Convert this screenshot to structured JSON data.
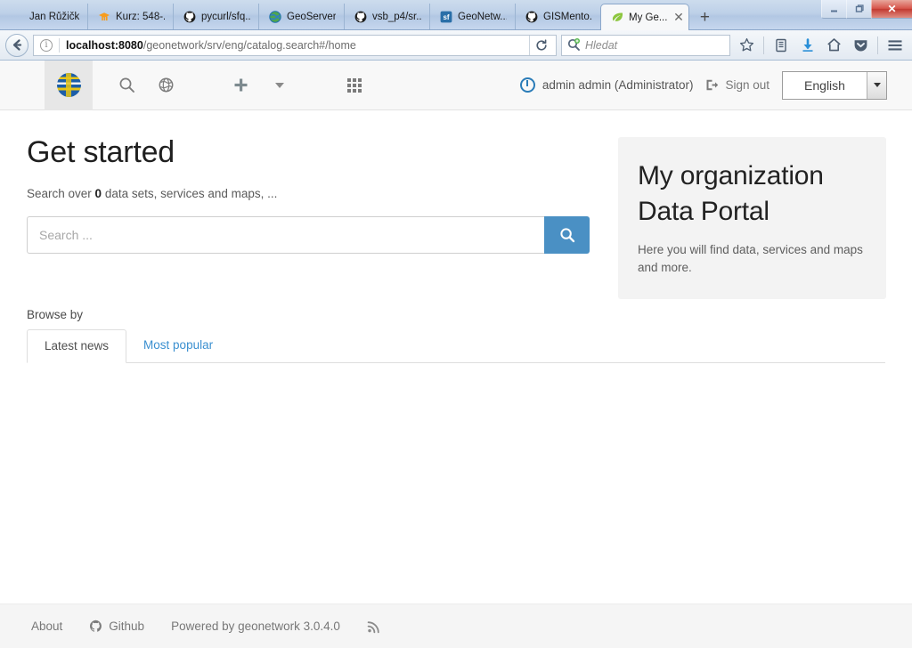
{
  "browser": {
    "tabs": [
      {
        "title": "Jan Růžička - s...",
        "favicon": "none-icon",
        "active": false
      },
      {
        "title": "Kurz: 548-...",
        "favicon": "moodle-icon",
        "active": false
      },
      {
        "title": "pycurl/sfq...",
        "favicon": "github-icon",
        "active": false
      },
      {
        "title": "GeoServer...",
        "favicon": "geoserver-icon",
        "active": false
      },
      {
        "title": "vsb_p4/sr...",
        "favicon": "github-icon",
        "active": false
      },
      {
        "title": "GeoNetw...",
        "favicon": "sourceforge-icon",
        "active": false
      },
      {
        "title": "GISMento...",
        "favicon": "github-icon",
        "active": false
      },
      {
        "title": "My Ge...",
        "favicon": "geonetwork-leaf-icon",
        "active": true
      }
    ],
    "new_tab_label": "+",
    "tab_close_label": "✕",
    "window_controls": {
      "minimize": "—",
      "restore": "❐",
      "close": "✕"
    },
    "back_label": "←",
    "url_host": "localhost:8080",
    "url_path": "/geonetwork/srv/eng/catalog.search#/home",
    "reload_label": "⟳",
    "search_placeholder": "Hledat",
    "nav_icons": [
      "bookmark-star-icon",
      "library-icon",
      "downloads-icon",
      "home-icon",
      "pocket-icon",
      "menu-icon"
    ]
  },
  "app_header": {
    "logo_name": "geonetwork-logo",
    "nav_items": [
      {
        "name": "search-icon",
        "label": ""
      },
      {
        "name": "map-globe-icon",
        "label": ""
      },
      {
        "name": "add-icon",
        "label": ""
      },
      {
        "name": "chevron-down-icon",
        "label": ""
      },
      {
        "name": "apps-grid-icon",
        "label": ""
      }
    ],
    "user_label": "admin admin (Administrator)",
    "signout_label": "Sign out",
    "language": "English",
    "language_options": [
      "English"
    ]
  },
  "main": {
    "heading": "Get started",
    "subtitle_pre": "Search over ",
    "subtitle_count": "0",
    "subtitle_post": " data sets, services and maps, ...",
    "search_placeholder": "Search ...",
    "search_value": "",
    "search_button_label": "search-icon",
    "browse_label": "Browse by",
    "tabs": [
      {
        "label": "Latest news",
        "active": true
      },
      {
        "label": "Most popular",
        "active": false
      }
    ]
  },
  "portal_card": {
    "title_line1": "My organization",
    "title_line2": "Data Portal",
    "description": "Here you will find data, services and maps and more."
  },
  "footer": {
    "about_label": "About",
    "github_label": "Github",
    "powered_label": "Powered by geonetwork 3.0.4.0",
    "rss_label": "rss-icon"
  },
  "colors": {
    "accent": "#4a90c4",
    "link": "#3a8fd0",
    "card_bg": "#f3f3f3",
    "footer_bg": "#f5f5f5"
  }
}
